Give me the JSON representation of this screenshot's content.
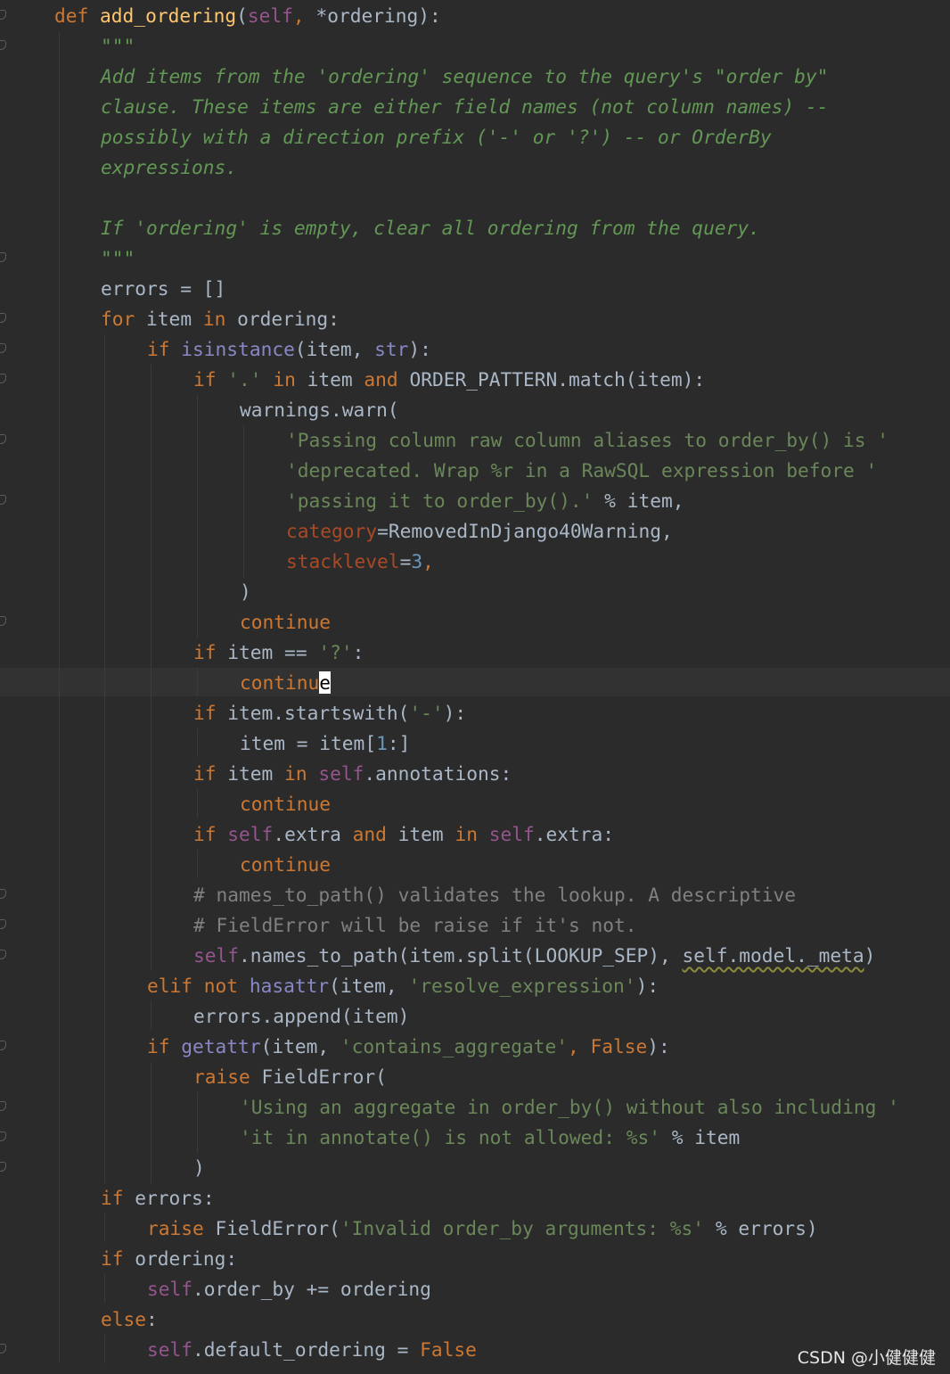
{
  "editor": {
    "language": "python",
    "theme_colors": {
      "background": "#2b2b2b",
      "keyword": "#cc7832",
      "function": "#ffc66d",
      "self": "#94558d",
      "string": "#6a8759",
      "docstring": "#629755",
      "comment": "#808080",
      "number": "#6897bb",
      "builtin": "#8888c6",
      "kwarg": "#aa4926",
      "plain": "#a9b7c6"
    },
    "tokens": {
      "def": "def",
      "fname": "add_ordering",
      "p_open": "(",
      "self": "self",
      "comma_sp": ", ",
      "star_ordering": "*ordering",
      "sig_end": "):",
      "doc_quote": "\"\"\"",
      "doc_1": "Add items from the 'ordering' sequence to the query's \"order by\"",
      "doc_2": "clause. These items are either field names (not column names) --",
      "doc_3": "possibly with a direction prefix ('-' or '?') -- or OrderBy",
      "doc_4": "expressions.",
      "doc_5": "If 'ordering' is empty, clear all ordering from the query.",
      "errors_init": "errors = []",
      "for": "for",
      "item": "item",
      "in": "in",
      "ordering_colon": "ordering:",
      "if": "if",
      "isinstance": "isinstance",
      "item_comma": "(item, ",
      "str": "str",
      "close_colon": "):",
      "dot_str": "'.'",
      "and": "and",
      "order_pattern_match": "ORDER_PATTERN.match(item):",
      "warnings_warn": "warnings.warn(",
      "msg_1": "'Passing column raw column aliases to order_by() is '",
      "msg_2": "'deprecated. Wrap %r in a RawSQL expression before '",
      "msg_3": "'passing it to order_by().'",
      "percent_item_comma": " % item,",
      "category": "category",
      "category_val": "=RemovedInDjango40Warning,",
      "stacklevel": "stacklevel",
      "eq": "=",
      "three": "3",
      "comma": ",",
      "close_paren": ")",
      "continue": "continue",
      "continu": "continu",
      "caret_char": "e",
      "item_eqeq": "item == ",
      "q_str": "'?'",
      "colon": ":",
      "startswith": "item.startswith(",
      "dash_str": "'-'",
      "item_assign": "item = item[",
      "one": "1",
      "slice_end": ":]",
      "item_in": "item in ",
      "annotations": ".annotations:",
      "extra": ".extra ",
      "extra_colon": ".extra:",
      "cmt_1": "# names_to_path() validates the lookup. A descriptive",
      "cmt_2": "# FieldError will be raise if it's not.",
      "names_to_path": ".names_to_path(item.split(LOOKUP_SEP), ",
      "model_meta": "self.model._meta",
      "elif": "elif",
      "not": "not",
      "hasattr": "hasattr",
      "resolve_expr": "'resolve_expression'",
      "errors_append": "errors.append(item)",
      "getattr": "getattr",
      "contains_agg": "'contains_aggregate'",
      "false": "False",
      "raise": "raise",
      "field_error_open": "FieldError(",
      "agg_msg_1": "'Using an aggregate in order_by() without also including '",
      "agg_msg_2": "'it in annotate() is not allowed: %s'",
      "percent_item": " % item",
      "errors_colon": "errors:",
      "invalid_msg": "'Invalid order_by arguments: %s'",
      "percent_errors": " % errors)",
      "order_by_pluseq": ".order_by += ordering",
      "else": "else",
      "default_ordering": ".default_ordering = ",
      "sp": " "
    }
  },
  "watermark": "CSDN @小健健健"
}
